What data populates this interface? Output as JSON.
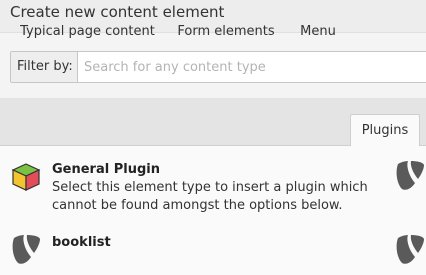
{
  "header": {
    "title": "Create new content element"
  },
  "filter": {
    "label": "Filter by:",
    "placeholder": "Search for any content type"
  },
  "tabs": [
    {
      "label": "Typical page content"
    },
    {
      "label": "Form elements"
    },
    {
      "label": "Menu"
    },
    {
      "label": "Plugins",
      "active": true
    }
  ],
  "elements": [
    {
      "title": "General Plugin",
      "description": "Select this element type to insert a plugin which cannot be found amongst the options below.",
      "icon": "cube-icon"
    },
    {
      "title": "booklist",
      "icon": "typo3-icon"
    }
  ],
  "colors": {
    "typo3_icon": "#5a5a5a",
    "cube_left": "#f4c430",
    "cube_right": "#e24d5a",
    "cube_top": "#7bc143"
  }
}
